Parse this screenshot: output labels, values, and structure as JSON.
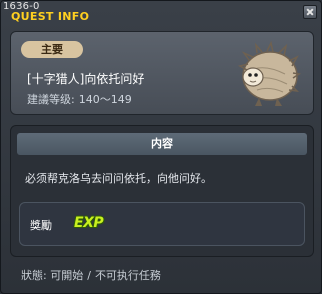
{
  "window": {
    "quest_id": "1636-0",
    "title": "QUEST INFO"
  },
  "quest": {
    "category": "主要",
    "name": "[十字猎人]向依托问好",
    "level_label": "建議等级:",
    "level_range": "140～149"
  },
  "content": {
    "header": "内容",
    "description": "必须帮克洛乌去问问依托，向他问好。"
  },
  "reward": {
    "label": "獎勵",
    "exp_text": "EXP"
  },
  "status": {
    "label": "狀態:",
    "state": "可開始",
    "separator": "/",
    "action": "不可执行任務"
  }
}
